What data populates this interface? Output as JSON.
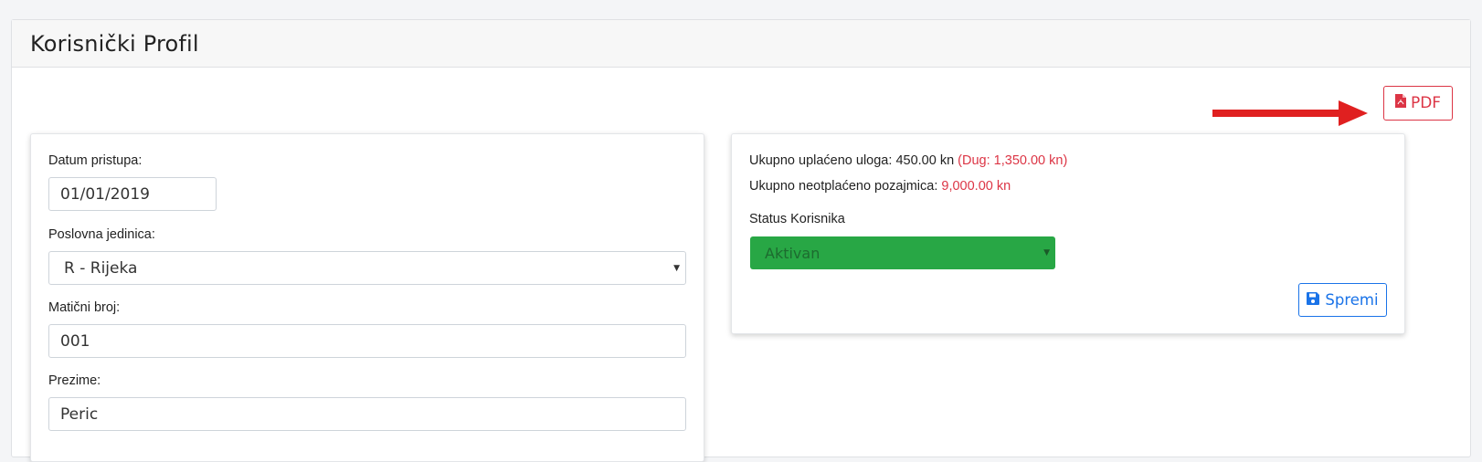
{
  "page": {
    "title": "Korisnički Profil"
  },
  "toolbar": {
    "pdf_label": "PDF",
    "pdf_color": "#dc3545"
  },
  "annotation": {
    "arrow_color": "#e02020"
  },
  "form": {
    "datum_pristupa": {
      "label": "Datum pristupa:",
      "value": "01/01/2019"
    },
    "poslovna_jedinica": {
      "label": "Poslovna jedinica:",
      "value": "R - Rijeka"
    },
    "maticni_broj": {
      "label": "Matični broj:",
      "value": "001"
    },
    "prezime": {
      "label": "Prezime:",
      "value": "Peric"
    }
  },
  "summary": {
    "uplaceno_label": "Ukupno uplaćeno uloga:",
    "uplaceno_value": "450.00 kn",
    "dug": "(Dug: 1,350.00 kn)",
    "neoplaceno_label": "Ukupno neotplaćeno pozajmica:",
    "neoplaceno_value": "9,000.00 kn",
    "status_label": "Status Korisnika",
    "status_value": "Aktivan",
    "status_color": "#28a745",
    "save_label": "Spremi",
    "save_color": "#1a73e8"
  },
  "icons": {
    "pdf": "file-pdf-icon",
    "save": "floppy-disk-icon",
    "caret": "caret-down-icon"
  }
}
